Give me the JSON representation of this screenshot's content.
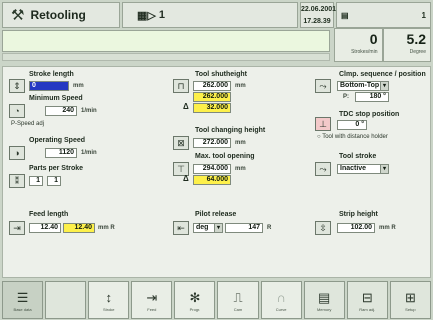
{
  "header": {
    "title": "Retooling",
    "program": "1",
    "date": "22.06.2001",
    "time": "17.28.39",
    "status_page": "1"
  },
  "counters": [
    {
      "value": "0",
      "label": "Strokes/min"
    },
    {
      "value": "5.2",
      "label": "Degree"
    }
  ],
  "fields": {
    "stroke_length": {
      "label": "Stroke length",
      "value": "0",
      "unit": "mm"
    },
    "minimum_speed": {
      "label": "Minimum Speed",
      "value": "240",
      "unit": "1/min"
    },
    "speed_check": "P-Speed adj",
    "operating_speed": {
      "label": "Operating Speed",
      "value": "1120",
      "unit": "1/min"
    },
    "parts_per_stroke": {
      "label": "Parts per Stroke",
      "value1": "1",
      "value2": "1"
    },
    "feed_length": {
      "label": "Feed length",
      "value": "12.40",
      "value_yellow": "12.40",
      "unit": "mm R"
    },
    "tool_shut_height": {
      "label": "Tool shutheight",
      "value": "262.000",
      "value_yellow": "262.000",
      "delta": "32.000",
      "unit": "mm"
    },
    "tool_changing_height": {
      "label": "Tool changing height",
      "value": "272.000",
      "unit": "mm"
    },
    "max_tool_opening": {
      "label": "Max. tool opening",
      "value": "294.000",
      "delta": "64.000",
      "unit": "mm"
    },
    "pilot_release": {
      "label": "Pilot release",
      "unit_select": "deg",
      "value": "147",
      "unit": "R"
    },
    "clmp_sequence": {
      "label": "Clmp. sequence / position",
      "value": "Bottom-Top",
      "position_prefix": "P:",
      "position": "180 °"
    },
    "tdc_stop": {
      "label": "TDC stop position",
      "value": "0 °"
    },
    "tool_with_holder": "Tool with distance holder",
    "tool_stroke": {
      "label": "Tool stroke",
      "value": "Inactive"
    },
    "strip_height": {
      "label": "Strip height",
      "value": "102.00",
      "unit": "mm R"
    }
  },
  "softkeys": [
    {
      "icon": "menu-icon",
      "glyph": "☰",
      "label": "Base data"
    },
    {
      "icon": "stroke-icon",
      "glyph": "↕",
      "label": "Stroke"
    },
    {
      "icon": "feed-icon",
      "glyph": "⇥",
      "label": "Feed"
    },
    {
      "icon": "gear-icon",
      "glyph": "✻",
      "label": "Progr."
    },
    {
      "icon": "pulse-icon",
      "glyph": "⎍",
      "label": "Cam"
    },
    {
      "icon": "curve-icon",
      "glyph": "∩",
      "label": "Curve"
    },
    {
      "icon": "document-icon",
      "glyph": "▤",
      "label": "Memory"
    },
    {
      "icon": "press-icon",
      "glyph": "⊟",
      "label": "Ram adj."
    },
    {
      "icon": "setup-icon",
      "glyph": "⊞",
      "label": "Setup"
    }
  ]
}
